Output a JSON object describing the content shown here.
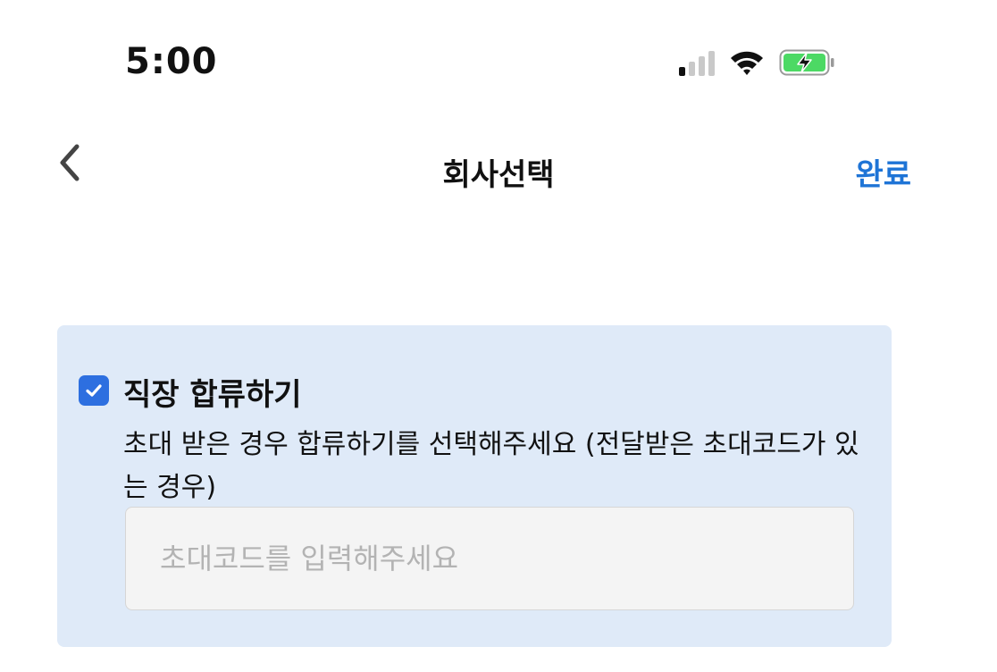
{
  "status_bar": {
    "time": "5:00",
    "icons": [
      "cellular-signal-icon",
      "wifi-icon",
      "battery-charging-icon"
    ],
    "battery_color": "#4cd964"
  },
  "nav": {
    "back_icon": "chevron-left-icon",
    "title": "회사선택",
    "done_label": "완료",
    "accent_color": "#1e74d6"
  },
  "join_card": {
    "checked": true,
    "title": "직장 합류하기",
    "description": "초대 받은 경우 합류하기를 선택해주세요 (전달받은 초대코드가 있는 경우)",
    "input_placeholder": "초대코드를 입력해주세요",
    "input_value": "",
    "background_color": "#dfeaf8",
    "checkbox_color": "#2d6fe0"
  }
}
